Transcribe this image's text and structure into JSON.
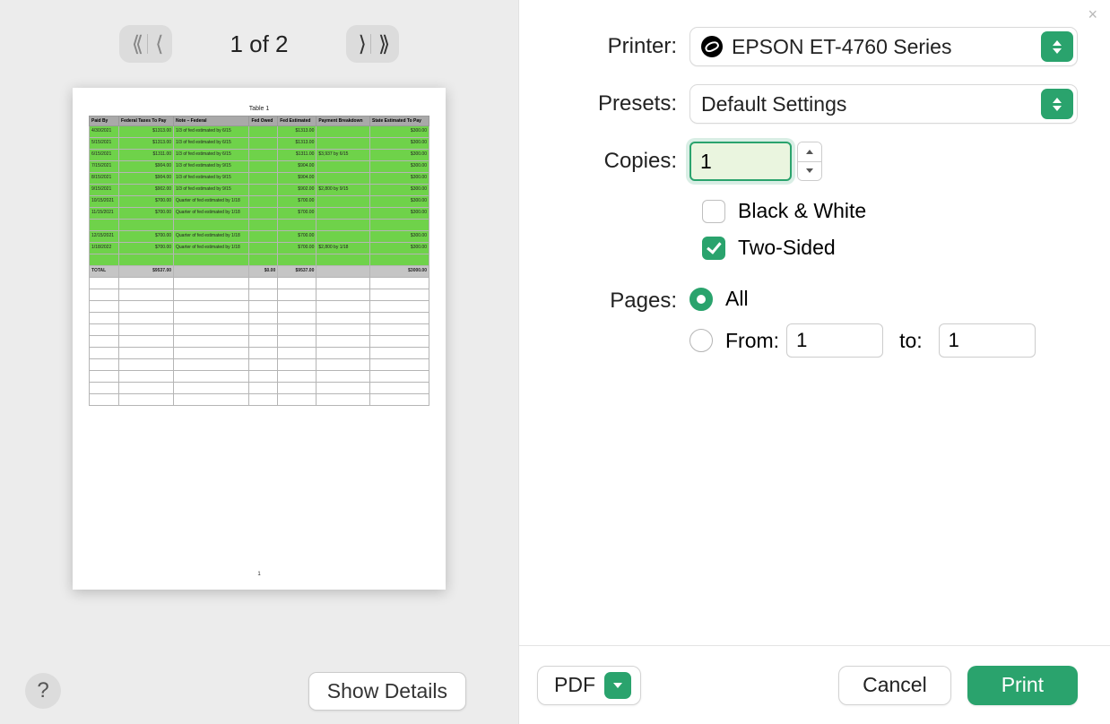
{
  "preview": {
    "page_counter": "1 of 2",
    "current_page_number": "1",
    "table_title": "Table 1",
    "headers": [
      "Paid By",
      "Federal Taxes To Pay",
      "Note – Federal",
      "Fed Owed",
      "Fed Estimated",
      "Payment Breakdown",
      "State Estimated To Pay"
    ],
    "rows": [
      {
        "cells": [
          "4/30/2021",
          "$1313.00",
          "1/3 of fed estimated by 6/15",
          "",
          "$1313.00",
          "",
          "$300.00"
        ],
        "green": true
      },
      {
        "cells": [
          "5/15/2021",
          "$1313.00",
          "1/3 of fed estimated by 6/15",
          "",
          "$1313.00",
          "",
          "$300.00"
        ],
        "green": true
      },
      {
        "cells": [
          "6/15/2021",
          "$1311.00",
          "1/3 of fed estimated by 6/15",
          "",
          "$1311.00",
          "$3,937 by 6/15",
          "$300.00"
        ],
        "green": true
      },
      {
        "cells": [
          "7/15/2021",
          "$904.00",
          "1/3 of fed estimated by 9/15",
          "",
          "$904.00",
          "",
          "$300.00"
        ],
        "green": true
      },
      {
        "cells": [
          "8/15/2021",
          "$904.00",
          "1/3 of fed estimated by 9/15",
          "",
          "$904.00",
          "",
          "$300.00"
        ],
        "green": true
      },
      {
        "cells": [
          "9/15/2021",
          "$902.00",
          "1/3 of fed estimated by 9/15",
          "",
          "$902.00",
          "$2,800 by 9/15",
          "$300.00"
        ],
        "green": true
      },
      {
        "cells": [
          "10/15/2021",
          "$700.00",
          "Quarter of fed estimated by 1/18",
          "",
          "$700.00",
          "",
          "$300.00"
        ],
        "green": true
      },
      {
        "cells": [
          "11/15/2021",
          "$700.00",
          "Quarter of fed estimated by 1/18",
          "",
          "$700.00",
          "",
          "$300.00"
        ],
        "green": true
      },
      {
        "cells": [
          "",
          "",
          "",
          "",
          "",
          "",
          ""
        ],
        "green": true
      },
      {
        "cells": [
          "12/15/2021",
          "$700.00",
          "Quarter of fed estimated by 1/18",
          "",
          "$700.00",
          "",
          "$300.00"
        ],
        "green": true
      },
      {
        "cells": [
          "1/18/2022",
          "$700.00",
          "Quarter of fed estimated by 1/18",
          "",
          "$700.00",
          "$2,800 by 1/18",
          "$300.00"
        ],
        "green": true
      },
      {
        "cells": [
          "",
          "",
          "",
          "",
          "",
          "",
          ""
        ],
        "green": true
      },
      {
        "cells": [
          "TOTAL",
          "$9537.00",
          "",
          "$0.00",
          "$9537.00",
          "",
          "$3000.00"
        ],
        "total": true
      }
    ],
    "empty_row_count": 11,
    "show_details_label": "Show Details",
    "help_label": "?"
  },
  "settings": {
    "printer_label": "Printer:",
    "printer_value": "EPSON ET-4760 Series",
    "presets_label": "Presets:",
    "presets_value": "Default Settings",
    "copies_label": "Copies:",
    "copies_value": "1",
    "bw_label": "Black & White",
    "bw_checked": false,
    "two_sided_label": "Two-Sided",
    "two_sided_checked": true,
    "pages_label": "Pages:",
    "pages_all_label": "All",
    "pages_all_selected": true,
    "pages_from_label": "From:",
    "pages_from_value": "1",
    "pages_to_label": "to:",
    "pages_to_value": "1"
  },
  "footer": {
    "pdf_label": "PDF",
    "cancel_label": "Cancel",
    "print_label": "Print"
  },
  "annotation": {
    "arrow_color": "#8abb4f"
  }
}
